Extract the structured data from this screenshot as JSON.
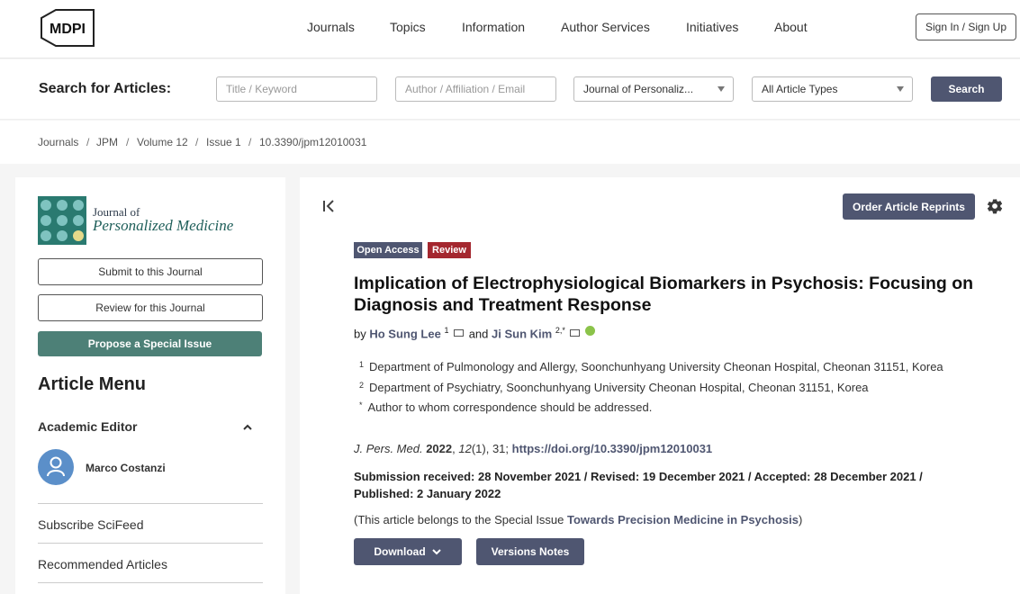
{
  "header": {
    "logo_text": "MDPI",
    "nav": [
      "Journals",
      "Topics",
      "Information",
      "Author Services",
      "Initiatives",
      "About"
    ],
    "sign_in": "Sign In / Sign Up"
  },
  "search": {
    "label": "Search for Articles:",
    "title_placeholder": "Title / Keyword",
    "author_placeholder": "Author / Affiliation / Email",
    "journal_select": "Journal of Personaliz...",
    "type_select": "All Article Types",
    "button": "Search"
  },
  "breadcrumb": [
    "Journals",
    "JPM",
    "Volume 12",
    "Issue 1",
    "10.3390/jpm12010031"
  ],
  "sidebar": {
    "journal_of": "Journal of",
    "journal_name": "Personalized Medicine",
    "submit": "Submit to this Journal",
    "review": "Review for this Journal",
    "propose": "Propose a Special Issue",
    "article_menu": "Article Menu",
    "academic_editor": "Academic Editor",
    "editor_name": "Marco Costanzi",
    "links": [
      "Subscribe SciFeed",
      "Recommended Articles"
    ]
  },
  "article": {
    "reprints": "Order Article Reprints",
    "badges": [
      "Open Access",
      "Review"
    ],
    "badge_colors": [
      "#4f5671",
      "#a4272f"
    ],
    "title": "Implication of Electrophysiological Biomarkers in Psychosis: Focusing on Diagnosis and Treatment Response",
    "by": "by",
    "author1": "Ho Sung Lee",
    "author1_sup": "1",
    "and": "and",
    "author2": "Ji Sun Kim",
    "author2_sup": "2,*",
    "affiliations": [
      {
        "n": "1",
        "text": "Department of Pulmonology and Allergy, Soonchunhyang University Cheonan Hospital, Cheonan 31151, Korea"
      },
      {
        "n": "2",
        "text": "Department of Psychiatry, Soonchunhyang University Cheonan Hospital, Cheonan 31151, Korea"
      },
      {
        "n": "*",
        "text": "Author to whom correspondence should be addressed."
      }
    ],
    "citation": {
      "journal": "J. Pers. Med.",
      "year": "2022",
      "volume": "12",
      "rest": "(1), 31; ",
      "doi": "https://doi.org/10.3390/jpm12010031"
    },
    "dates": "Submission received: 28 November 2021 / Revised: 19 December 2021 / Accepted: 28 December 2021 / Published: 2 January 2022",
    "special_prefix": "(This article belongs to the Special Issue ",
    "special_issue": "Towards Precision Medicine in Psychosis",
    "special_suffix": ")",
    "download": "Download",
    "versions": "Versions Notes"
  }
}
